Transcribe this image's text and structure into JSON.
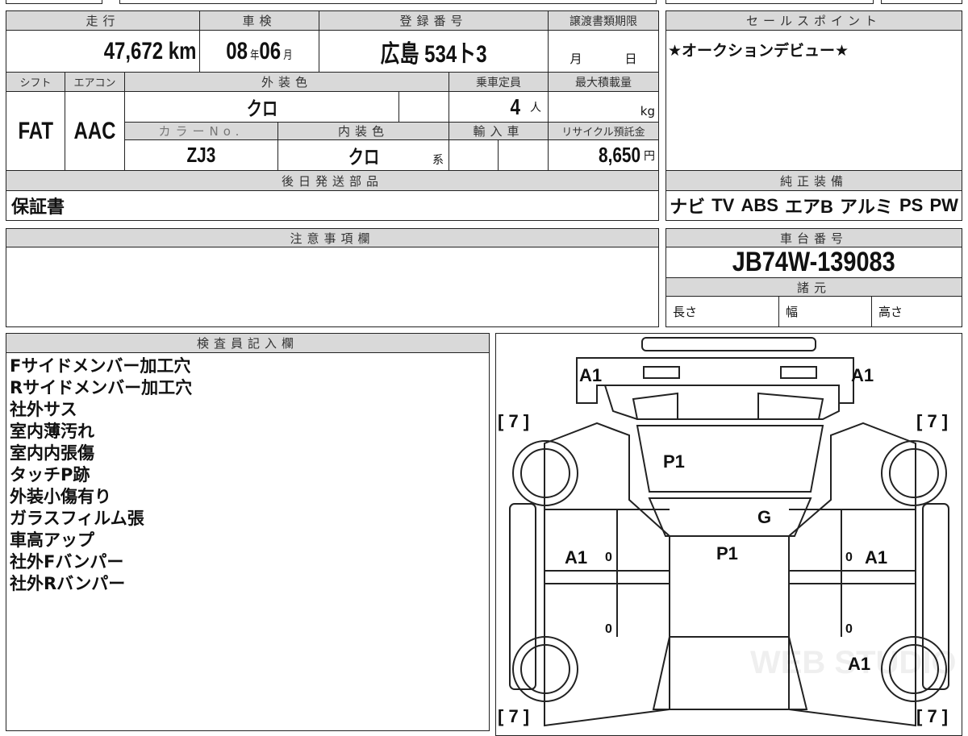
{
  "header_labels": {
    "mileage": "走行",
    "inspection": "車検",
    "registration": "登録番号",
    "transfer_deadline": "譲渡書類期限",
    "shift": "シフト",
    "aircon": "エアコン",
    "exterior_color": "外装色",
    "capacity": "乗車定員",
    "max_load": "最大積載量",
    "color_no": "カラーNo.",
    "interior_color": "内装色",
    "imported": "輸入車",
    "recycle_fee": "リサイクル預託金",
    "later_parts": "後日発送部品",
    "sales_point": "セールスポイント",
    "genuine_equipment": "純正装備",
    "notes": "注意事項欄",
    "chassis_no": "車台番号",
    "specs": "諸元",
    "inspector": "検査員記入欄"
  },
  "values": {
    "mileage": "47,672",
    "mileage_unit": "km",
    "inspection_year": "08",
    "year_unit": "年",
    "inspection_month": "06",
    "month_unit": "月",
    "registration": "広島 534ト3",
    "transfer_month": "月",
    "transfer_day": "日",
    "shift": "FAT",
    "aircon": "AAC",
    "exterior_color": "クロ",
    "capacity": "4",
    "capacity_unit": "人",
    "max_load_unit": "kg",
    "color_no": "ZJ3",
    "interior_color": "クロ",
    "interior_suffix": "系",
    "recycle_fee": "8,650",
    "recycle_unit": "円",
    "later_parts": "保証書",
    "sales_point": "★オークションデビュー★",
    "equipment": [
      "ナビ",
      "TV",
      "ABS",
      "エアB",
      "アルミ",
      "PS",
      "PW"
    ],
    "chassis_no": "JB74W-139083",
    "length": "長さ",
    "width": "幅",
    "height": "高さ"
  },
  "inspector_notes": [
    "Fサイドメンバー加工穴",
    "Rサイドメンバー加工穴",
    "社外サス",
    "室内薄汚れ",
    "室内内張傷",
    "タッチP跡",
    "外装小傷有り",
    "ガラスフィルム張",
    "車高アップ",
    "社外Fバンパー",
    "社外Rバンパー"
  ],
  "diagram": {
    "front_left": "A1",
    "front_right": "A1",
    "bracket_tl": "[ 7 ]",
    "bracket_tr": "[ 7 ]",
    "bracket_bl": "[ 7 ]",
    "bracket_br": "[ 7 ]",
    "windshield": "P1",
    "glass": "G",
    "roof": "P1",
    "left_door": "A1",
    "right_door": "A1",
    "rear_right": "A1",
    "zero_marks": [
      "0",
      "0",
      "0",
      "0"
    ],
    "watermark": "WEB STUDIO"
  }
}
